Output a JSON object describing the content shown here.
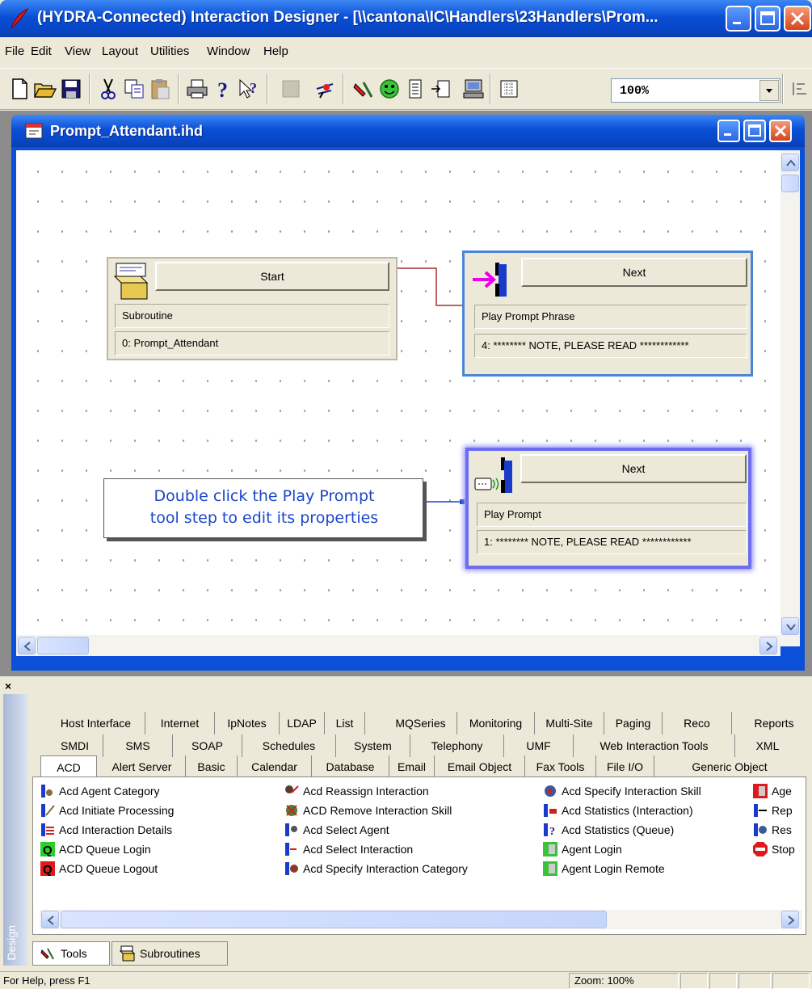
{
  "window": {
    "title": "(HYDRA-Connected) Interaction Designer - [\\\\cantona\\IC\\Handlers\\23Handlers\\Prom..."
  },
  "menu": [
    "File",
    "Edit",
    "View",
    "Layout",
    "Utilities",
    "Window",
    "Help"
  ],
  "toolbar": {
    "zoom_value": "100%"
  },
  "child": {
    "title": "Prompt_Attendant.ihd"
  },
  "steps": {
    "start": {
      "button": "Start",
      "field1": "Subroutine",
      "field2": "0: Prompt_Attendant"
    },
    "phrase": {
      "button": "Next",
      "field1": "Play Prompt Phrase",
      "field2": "4: ******** NOTE, PLEASE READ ************"
    },
    "prompt": {
      "button": "Next",
      "field1": "Play Prompt",
      "field2": "1: ******** NOTE, PLEASE READ ************"
    }
  },
  "callout": {
    "line1": "Double click the Play Prompt",
    "line2": "tool step to edit its properties"
  },
  "design": {
    "side_label": "Design",
    "tabs_row1": [
      "Host Interface",
      "Internet",
      "IpNotes",
      "LDAP",
      "List",
      "MQSeries",
      "Monitoring",
      "Multi-Site",
      "Paging",
      "Reco",
      "Reports"
    ],
    "tabs_row2": [
      "SMDI",
      "SMS",
      "SOAP",
      "Schedules",
      "System",
      "Telephony",
      "UMF",
      "Web Interaction Tools",
      "XML"
    ],
    "tabs_row3": [
      "ACD",
      "Alert Server",
      "Basic",
      "Calendar",
      "Database",
      "Email",
      "Email Object",
      "Fax Tools",
      "File I/O",
      "Generic Object"
    ],
    "tools_col1": [
      "Acd Agent Category",
      "Acd Initiate Processing",
      "Acd Interaction Details",
      "ACD Queue Login",
      "ACD Queue Logout"
    ],
    "tools_col2": [
      "Acd Reassign Interaction",
      "ACD Remove Interaction Skill",
      "Acd Select Agent",
      "Acd Select Interaction",
      "Acd Specify Interaction Category"
    ],
    "tools_col3": [
      "Acd Specify Interaction Skill",
      "Acd Statistics (Interaction)",
      "Acd Statistics (Queue)",
      "Agent Login",
      "Agent Login Remote"
    ],
    "tools_col4": [
      "Age",
      "Rep",
      "Res",
      "Stop"
    ],
    "bottom_tabs": [
      "Tools",
      "Subroutines"
    ]
  },
  "status": {
    "help": "For Help, press F1",
    "zoom": "Zoom: 100%"
  }
}
